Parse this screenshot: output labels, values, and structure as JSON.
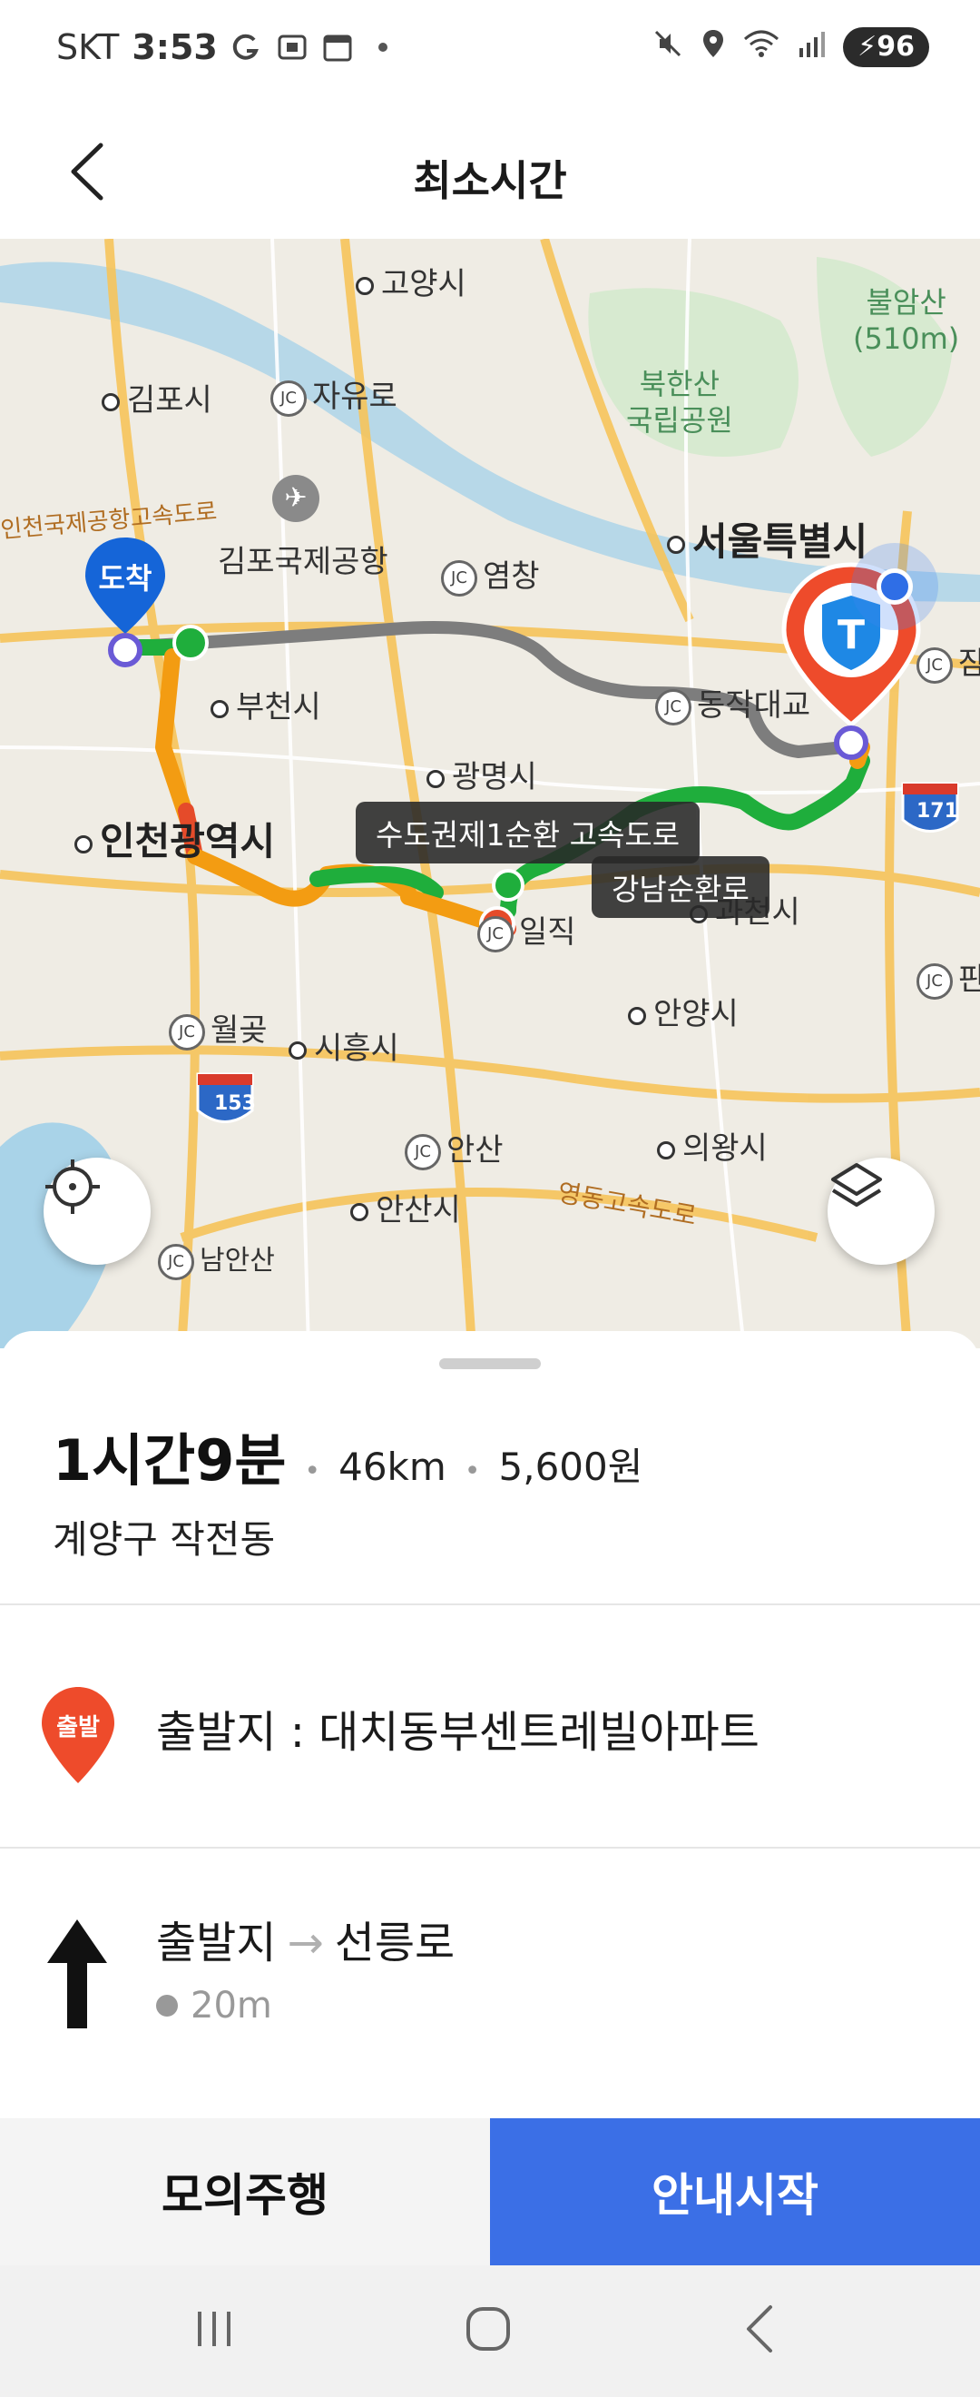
{
  "status_bar": {
    "carrier": "SKT",
    "time": "3:53",
    "battery": "96",
    "left_icons": [
      "g-icon",
      "screenshot-icon",
      "calendar-icon",
      "dot-icon"
    ],
    "right_icons": [
      "mute-icon",
      "location-icon",
      "wifi-icon",
      "signal-icon"
    ]
  },
  "header": {
    "title": "최소시간"
  },
  "map": {
    "labels": {
      "goyang": "고양시",
      "gimpo": "김포시",
      "jayuro": "자유로",
      "bukhansan": "북한산\n국립공원",
      "bulamsan": "불암산\n(510m)",
      "airport_expressway": "인천국제공항고속도로",
      "gimpo_airport": "김포국제공항",
      "yeomchang": "염창",
      "seoul": "서울특별시",
      "bucheon": "부천시",
      "dongjakdaegyo": "동작대교",
      "gwangmyeong": "광명시",
      "incheon": "인천광역시",
      "gwacheon": "과천시",
      "iljik": "일직",
      "anyang": "안양시",
      "wolgot": "월곶",
      "siheung": "시흥시",
      "ansan_jc": "안산",
      "uiwang": "의왕시",
      "ansan_city": "안산시",
      "yeongdong_expressway": "영동고속도로",
      "namansan": "남안산",
      "route_153": "153",
      "route_171": "171",
      "jam": "잠",
      "pan": "판",
      "arrival_marker": "도착",
      "jc": "JC"
    },
    "road_chips": {
      "capital_ring": "수도권제1순환 고속도로",
      "gangnam_ring": "강남순환로"
    }
  },
  "route": {
    "duration": "1시간9분",
    "distance": "46km",
    "toll": "5,600원",
    "destination": "계양구 작전동"
  },
  "start": {
    "badge": "출발",
    "label": "출발지 : 대치동부센트레빌아파트"
  },
  "step": {
    "from": "출발지",
    "to": "선릉로",
    "distance": "20m"
  },
  "buttons": {
    "simulate": "모의주행",
    "start_guidance": "안내시작"
  },
  "colors": {
    "accent_blue": "#3b6fe6",
    "route_green": "#1fae3c",
    "route_orange": "#f39c12",
    "route_red": "#e54b2a",
    "route_gray": "#7d7d7d",
    "start_red": "#ee4b2b",
    "marker_blue": "#1565d8"
  }
}
